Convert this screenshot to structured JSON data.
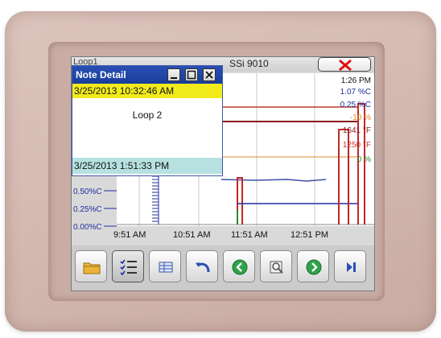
{
  "app": {
    "title": "SSi 9010",
    "left_label": "Loop1"
  },
  "note": {
    "title": "Note Detail",
    "date_start": "3/25/2013 10:32:46 AM",
    "text": "Loop 2",
    "date_end": "3/25/2013 1:51:33 PM"
  },
  "chart": {
    "legend": {
      "time": "1:26 PM",
      "items": [
        {
          "label": "1.07 %C",
          "color": "#1d2f9e"
        },
        {
          "label": "0.25 %C",
          "color": "#1d2f9e"
        },
        {
          "label": "-10 %",
          "color": "#e08a2e"
        },
        {
          "label": "1641 °F",
          "color": "#8b1a1a"
        },
        {
          "label": "1250 °F",
          "color": "#c23a2a"
        },
        {
          "label": "0 %",
          "color": "#2a8a2a"
        }
      ]
    },
    "y_labels": [
      "0.50%C",
      "0.25%C",
      "0.00%C"
    ],
    "x_labels": [
      "9:51 AM",
      "10:51 AM",
      "11:51 AM",
      "12:51 PM"
    ]
  },
  "chart_data": {
    "type": "line",
    "x": [
      "9:51 AM",
      "10:51 AM",
      "11:51 AM",
      "12:51 PM"
    ],
    "y_ticks": [
      "0.50%C",
      "0.25%C",
      "0.00%C"
    ],
    "legend_values": [
      "1.07 %C",
      "0.25 %C",
      "-10 %",
      "1641 °F",
      "1250 °F",
      "0 %"
    ],
    "grid": true
  },
  "toolbar": {
    "buttons": [
      {
        "icon": "folder-icon"
      },
      {
        "icon": "checklist-icon"
      },
      {
        "icon": "table-icon"
      },
      {
        "icon": "undo-icon"
      },
      {
        "icon": "arrow-left-icon"
      },
      {
        "icon": "zoom-icon"
      },
      {
        "icon": "arrow-right-icon"
      },
      {
        "icon": "skip-end-icon"
      }
    ]
  },
  "colors": {
    "bezel": "#d4bab2",
    "note_header": "#1f47a8",
    "note_start": "#f2eb1c",
    "note_end": "#b7e1e1",
    "trend_red": "#c0282a",
    "trend_blue": "#1d2f9e",
    "nav_green": "#2fa14a"
  }
}
